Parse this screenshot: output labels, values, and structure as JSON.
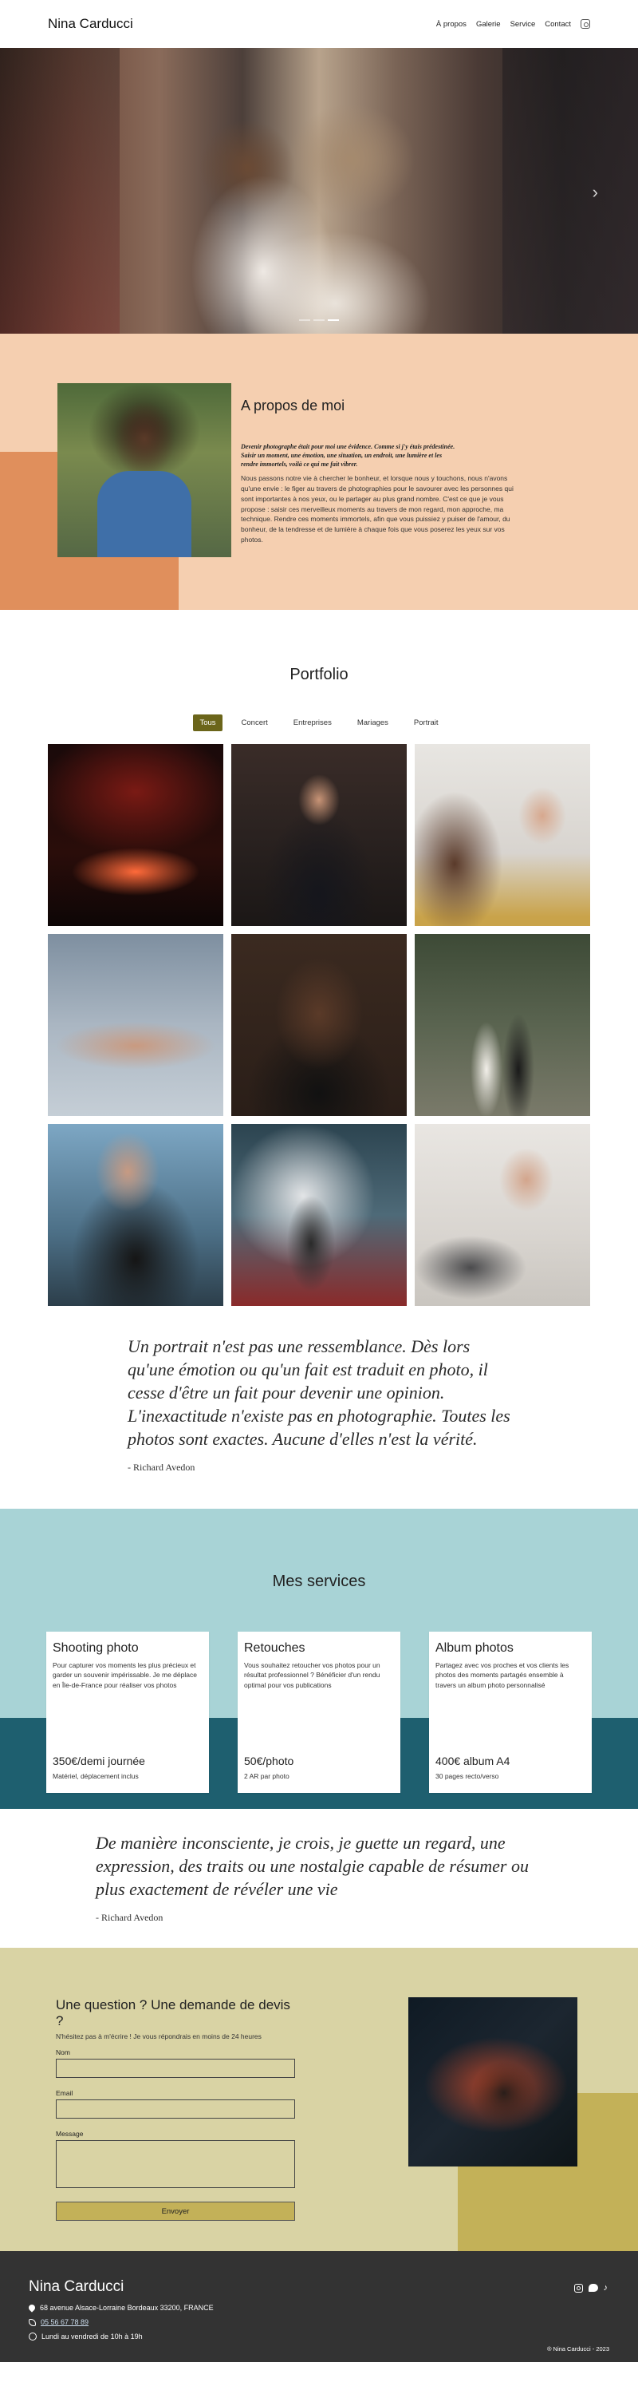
{
  "header": {
    "brand": "Nina Carducci",
    "nav": [
      "À propos",
      "Galerie",
      "Service",
      "Contact"
    ],
    "instagram_icon": "instagram-icon"
  },
  "hero": {
    "slides_count": 3,
    "active_slide": 3,
    "next_arrow": "›"
  },
  "about": {
    "title": "A propos de moi",
    "lead": "Devenir photographe était pour moi une évidence. Comme si j'y étais prédestinée. Saisir un moment, une émotion, une situation, un endroit, une lumière et les rendre immortels, voilà ce qui me fait vibrer.",
    "body": "Nous passons notre vie à chercher le bonheur, et lorsque nous y touchons, nous n'avons qu'une envie : le figer au travers de photographies pour le savourer avec les personnes qui sont importantes à nos yeux, ou le partager au plus grand nombre. C'est ce que je vous propose : saisir ces merveilleux moments au travers de mon regard, mon approche, ma technique. Rendre ces moments immortels, afin que vous puissiez y puiser de l'amour, du bonheur, de la tendresse et de lumière à chaque fois que vous poserez les yeux sur vos photos."
  },
  "portfolio": {
    "title": "Portfolio",
    "filters": [
      "Tous",
      "Concert",
      "Entreprises",
      "Mariages",
      "Portrait"
    ],
    "active_filter": "Tous",
    "images": [
      "concert",
      "entreprise",
      "entreprise",
      "portrait",
      "portrait",
      "mariage",
      "portrait",
      "concert",
      "entreprise"
    ]
  },
  "quote1": {
    "text": "Un portrait n'est pas une ressemblance. Dès lors qu'une émotion ou qu'un fait est traduit en photo, il cesse d'être un fait pour devenir une opinion. L'inexactitude n'existe pas en photographie. Toutes les photos sont exactes. Aucune d'elles n'est la vérité.",
    "author": "- Richard Avedon"
  },
  "services": {
    "title": "Mes services",
    "cards": [
      {
        "title": "Shooting photo",
        "desc": "Pour capturer vos moments les plus précieux et garder un souvenir impérissable. Je me déplace en Île-de-France pour réaliser vos photos",
        "price": "350€/demi journée",
        "note": "Matériel, déplacement inclus"
      },
      {
        "title": "Retouches",
        "desc": "Vous souhaitez retoucher vos photos pour un résultat professionnel ? Bénéficier d'un rendu optimal pour vos publications",
        "price": "50€/photo",
        "note": "2 AR par photo"
      },
      {
        "title": "Album photos",
        "desc": "Partagez avec vos proches et vos clients les photos des moments partagés ensemble à travers un album photo personnalisé",
        "price": "400€ album A4",
        "note": "30 pages recto/verso"
      }
    ]
  },
  "quote2": {
    "text": "De manière inconsciente, je crois, je guette un regard, une expression, des traits ou une nostalgie capable de résumer ou plus exactement de révéler une vie",
    "author": "- Richard Avedon"
  },
  "contact": {
    "title": "Une question ? Une demande de devis ?",
    "subtitle": "N'hésitez pas à m'écrire ! Je vous répondrais en moins de 24 heures",
    "name_label": "Nom",
    "email_label": "Email",
    "message_label": "Message",
    "submit_label": "Envoyer"
  },
  "footer": {
    "brand": "Nina Carducci",
    "address": "68 avenue Alsace-Lorraine Bordeaux 33200, FRANCE",
    "phone": "05 56 67 78 89",
    "hours": "Lundi au vendredi de 10h à 19h",
    "social_icons": [
      "instagram-icon",
      "twitter-icon",
      "tiktok-icon"
    ],
    "copyright": "® Nina Carducci - 2023"
  },
  "colors": {
    "about_bg": "#f5cfb0",
    "about_accent": "#e08f5c",
    "filter_active": "#6b651a",
    "services_bg": "#a8d3d6",
    "services_band": "#1e5f6f",
    "contact_bg": "#d9d3a4",
    "contact_accent": "#c3b158",
    "footer_bg": "#333333"
  }
}
